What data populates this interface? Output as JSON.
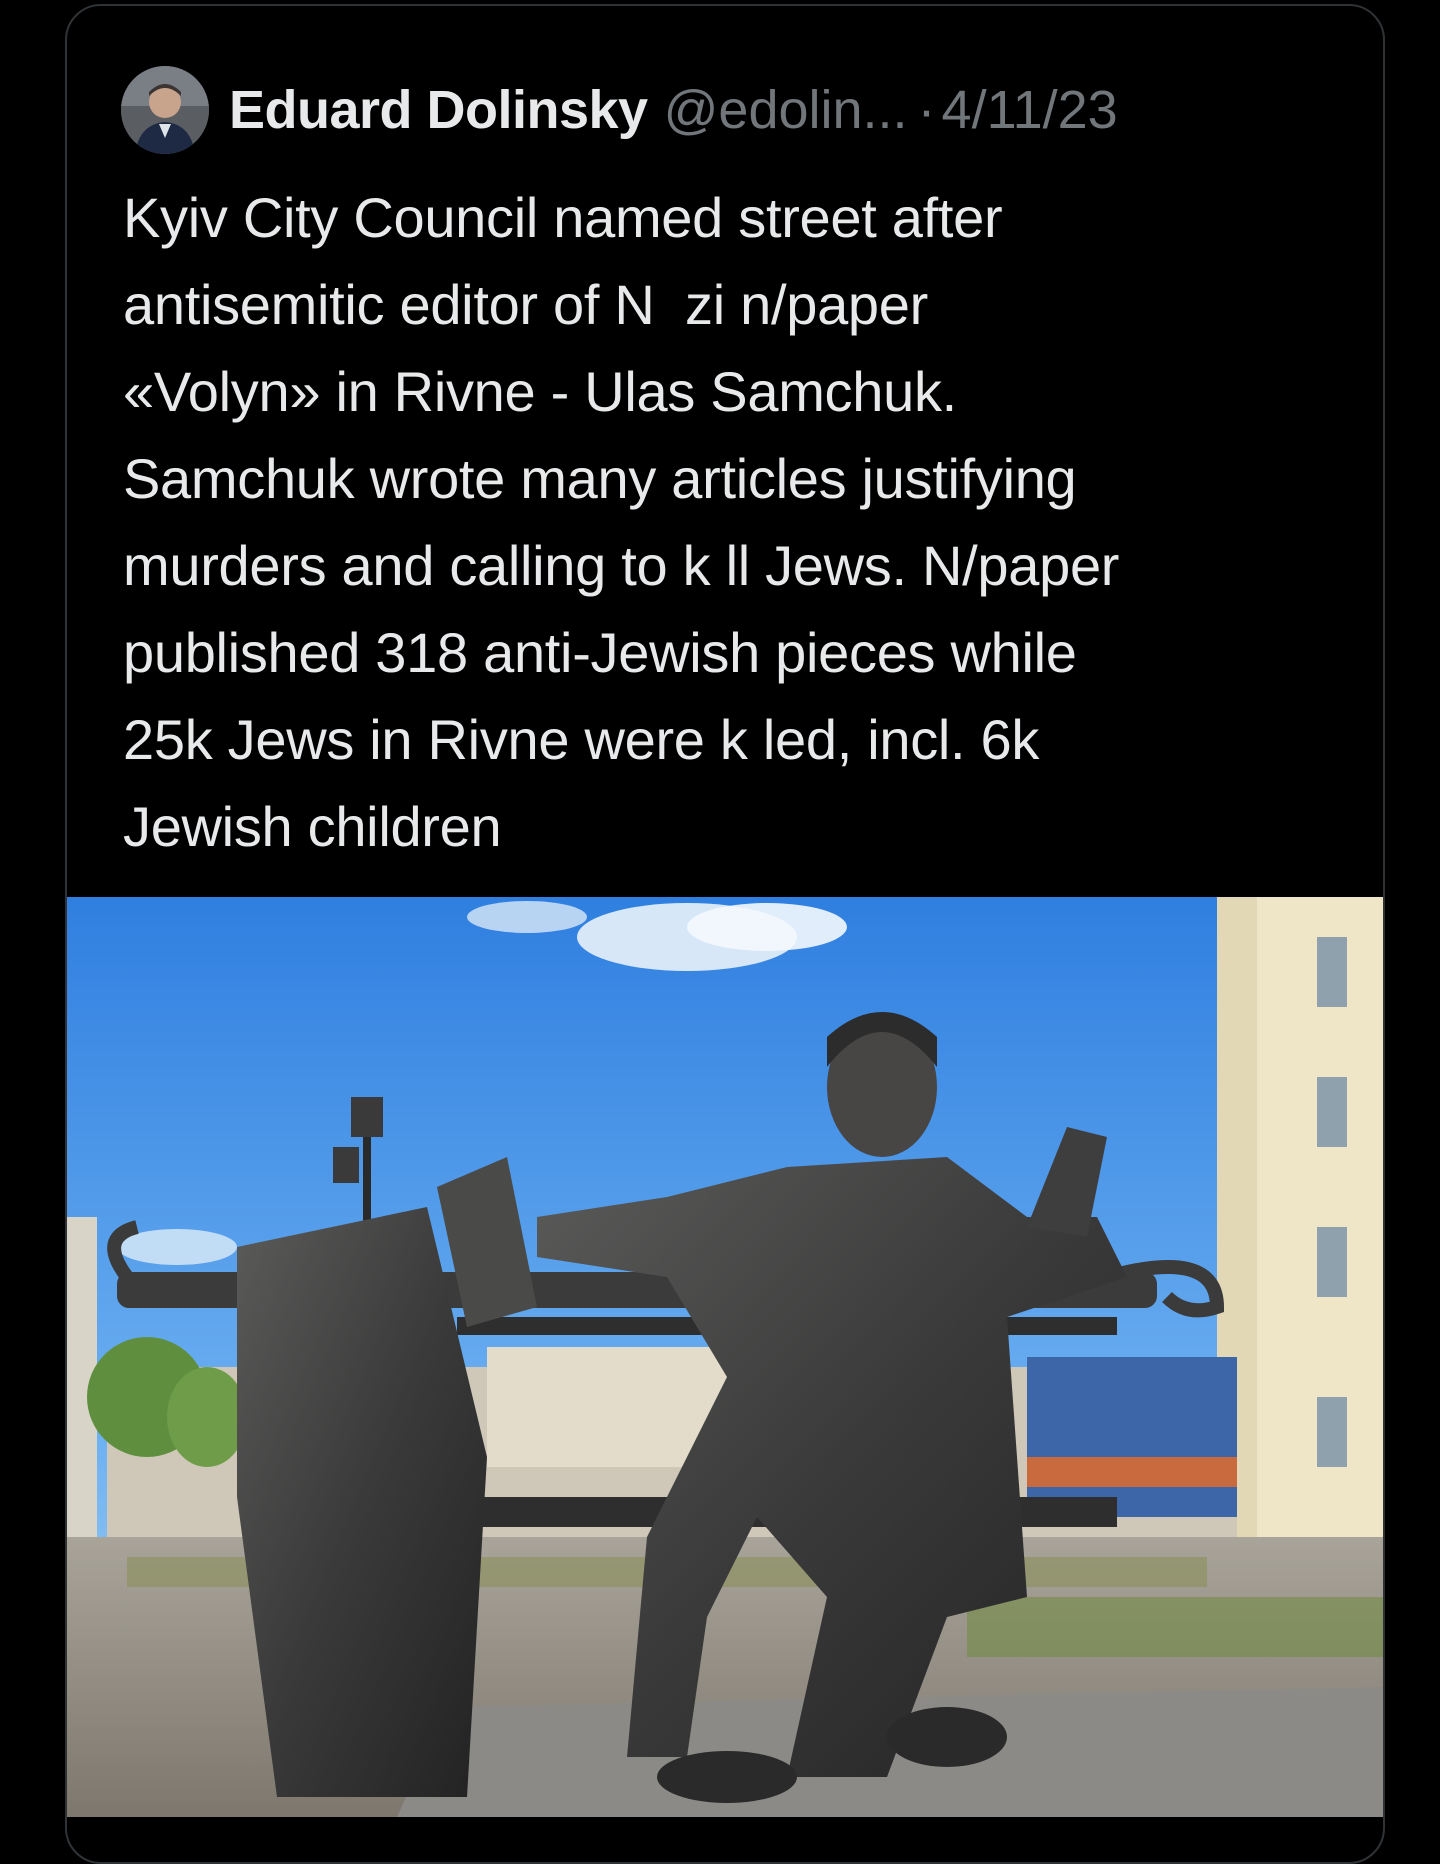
{
  "tweet": {
    "author": {
      "display_name": "Eduard Dolinsky",
      "handle": "@edolin...",
      "avatar_icon": "user-avatar-photo"
    },
    "separator": "·",
    "date": "4/11/23",
    "text_lines": [
      "Kyiv City Council named street after",
      "antisemitic editor of N  zi n/paper",
      "«Volyn» in Rivne - Ulas Samchuk.",
      "Samchuk wrote many articles justifying",
      "murders and calling to k ll Jews. N/paper",
      "published 318 anti-Jewish pieces while",
      "25k Jews in Rivne were k led, incl. 6k",
      "Jewish children"
    ],
    "media": {
      "type": "photo",
      "subject": "bronze-statue-on-bench-photo"
    }
  },
  "colors": {
    "background": "#000000",
    "primary_text": "#e7e9ea",
    "secondary_text": "#71767b",
    "card_border": "#2f3336"
  }
}
